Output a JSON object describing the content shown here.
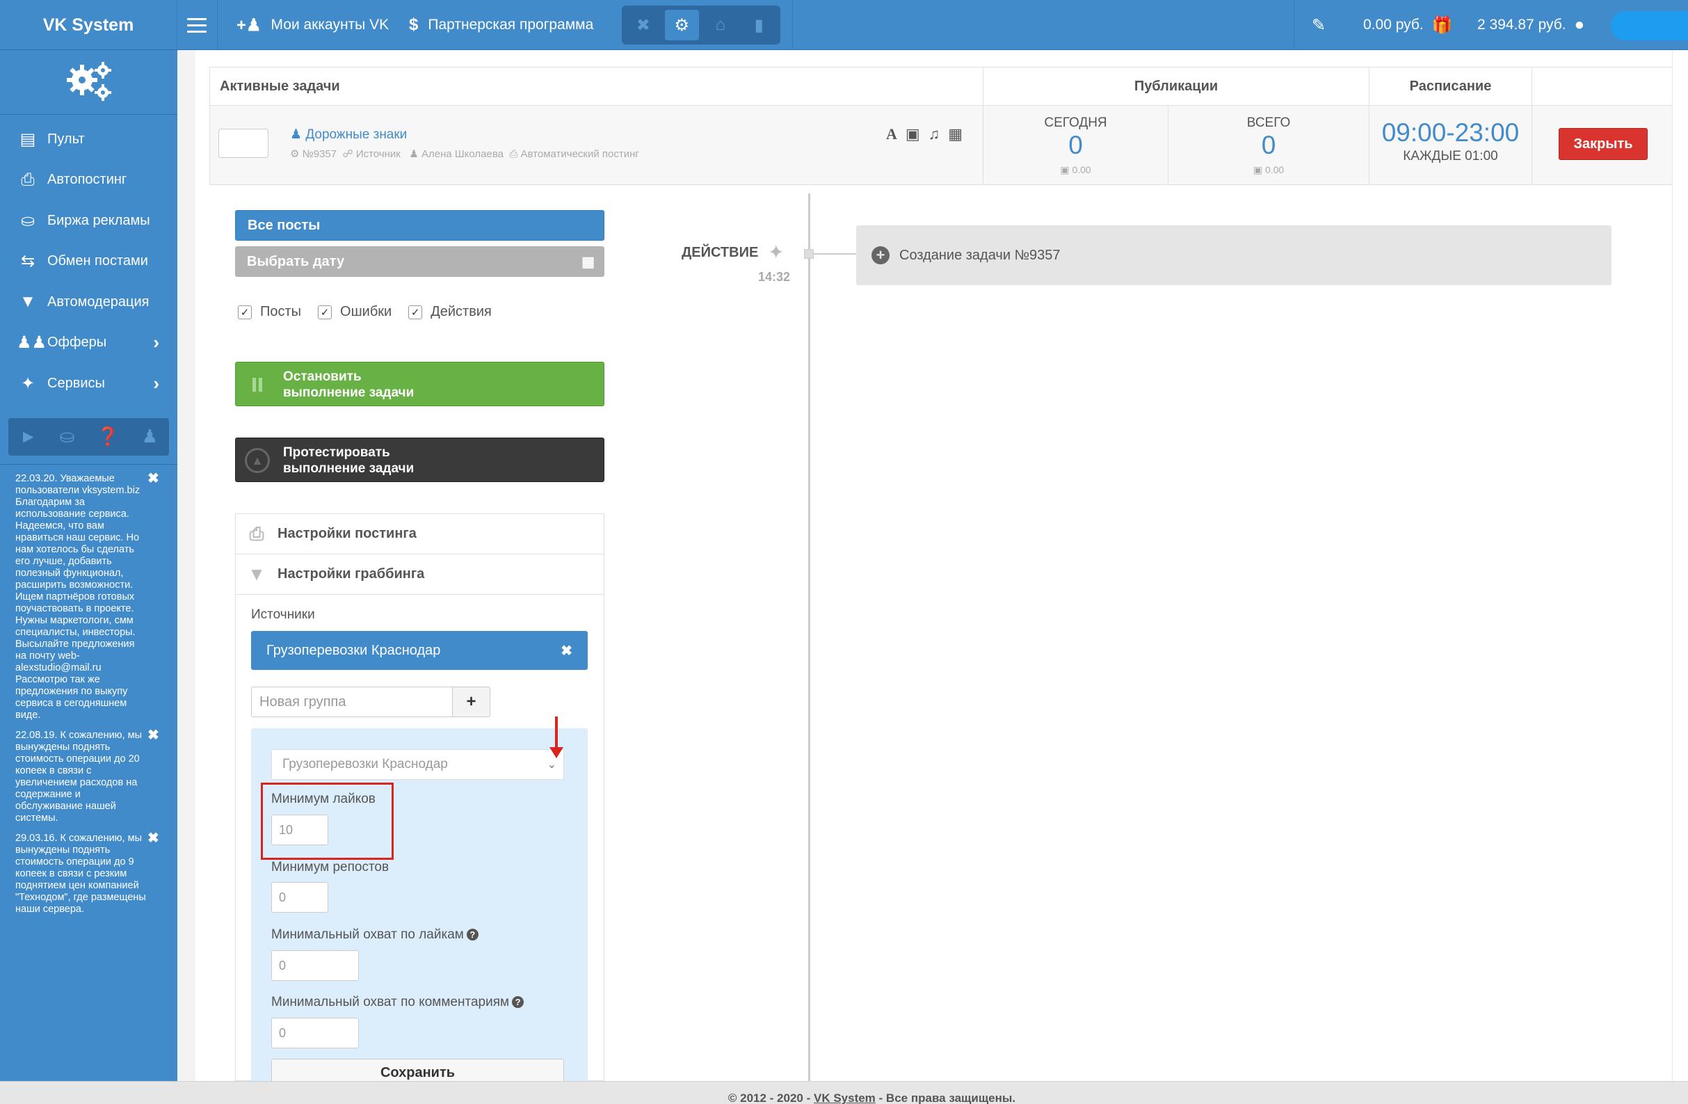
{
  "brand": "VK System",
  "top_nav": {
    "accounts_label": "Мои аккаунты VK",
    "partner_label": "Партнерская программа",
    "balance1": "0.00 руб.",
    "balance2": "2 394.87 руб."
  },
  "sidebar": {
    "items": [
      {
        "label": "Пульт",
        "icon": "monitor-icon"
      },
      {
        "label": "Автопостинг",
        "icon": "printer-icon"
      },
      {
        "label": "Биржа рекламы",
        "icon": "coins-icon"
      },
      {
        "label": "Обмен постами",
        "icon": "exchange-icon"
      },
      {
        "label": "Автомодерация",
        "icon": "filter-icon"
      },
      {
        "label": "Офферы",
        "icon": "users-icon"
      },
      {
        "label": "Сервисы",
        "icon": "magic-wand-icon"
      }
    ],
    "news": [
      "22.03.20. Уважаемые пользователи vksystem.biz Благодарим за использование сервиса. Надеемся, что вам нравиться наш сервис. Но нам хотелось бы сделать его лучше, добавить полезный функционал, расширить возможности. Ищем партнёров готовых поучаствовать в проекте. Нужны маркетологи, смм специалисты, инвесторы. Высылайте предложения на почту web-alexstudio@mail.ru Рассмотрю так же предложения по выкупу сервиса в сегодняшнем виде.",
      "22.08.19. К сожалению, мы вынуждены поднять стоимость операции до 20 копеек в связи с увеличением расходов на содержание и обслуживание нашей системы.",
      "29.03.16. К сожалению, мы вынуждены поднять стоимость операции до 9 копеек в связи с резким поднятием цен компанией \"Технодом\", где размещены наши сервера."
    ]
  },
  "task_table": {
    "headers": {
      "active": "Активные задачи",
      "publications": "Публикации",
      "schedule": "Расписание"
    },
    "task": {
      "title": "Дорожные знаки",
      "number": "№9357",
      "source": "Источник",
      "author": "Алена Школаева",
      "type": "Автоматический постинг"
    },
    "today": {
      "label": "СЕГОДНЯ",
      "value": "0",
      "sub": "0.00"
    },
    "total": {
      "label": "ВСЕГО",
      "value": "0",
      "sub": "0.00"
    },
    "schedule": {
      "time": "09:00-23:00",
      "every": "КАЖДЫЕ 01:00"
    },
    "close_label": "Закрыть"
  },
  "left_panel": {
    "all_posts": "Все посты",
    "pick_date": "Выбрать дату",
    "filters": [
      "Посты",
      "Ошибки",
      "Действия"
    ],
    "stop_line1": "Остановить",
    "stop_line2": "выполнение задачи",
    "test_line1": "Протестировать",
    "test_line2": "выполнение задачи",
    "posting_settings": "Настройки постинга",
    "grabbing_settings": "Настройки граббинга",
    "sources_label": "Источники",
    "source_tag": "Грузоперевозки Краснодар",
    "new_group_placeholder": "Новая группа",
    "select_value": "Грузоперевозки Краснодар",
    "min_likes_label": "Минимум лайков",
    "min_likes_value": "10",
    "min_reposts_label": "Минимум репостов",
    "min_reposts_value": "0",
    "min_reach_likes_label": "Минимальный охват по лайкам",
    "min_reach_likes_value": "0",
    "min_reach_comments_label": "Минимальный охват по комментариям",
    "min_reach_comments_value": "0",
    "save_label": "Сохранить"
  },
  "timeline": {
    "action_label": "ДЕЙСТВИЕ",
    "time": "14:32",
    "event": "Создание задачи №9357"
  },
  "footer": {
    "prefix": "© 2012 - 2020 -",
    "link": "VK System",
    "suffix": "- Все права защищены."
  },
  "colors": {
    "primary": "#428bca",
    "success": "#68b245",
    "danger": "#d9352e",
    "dark": "#3a3a3a"
  }
}
